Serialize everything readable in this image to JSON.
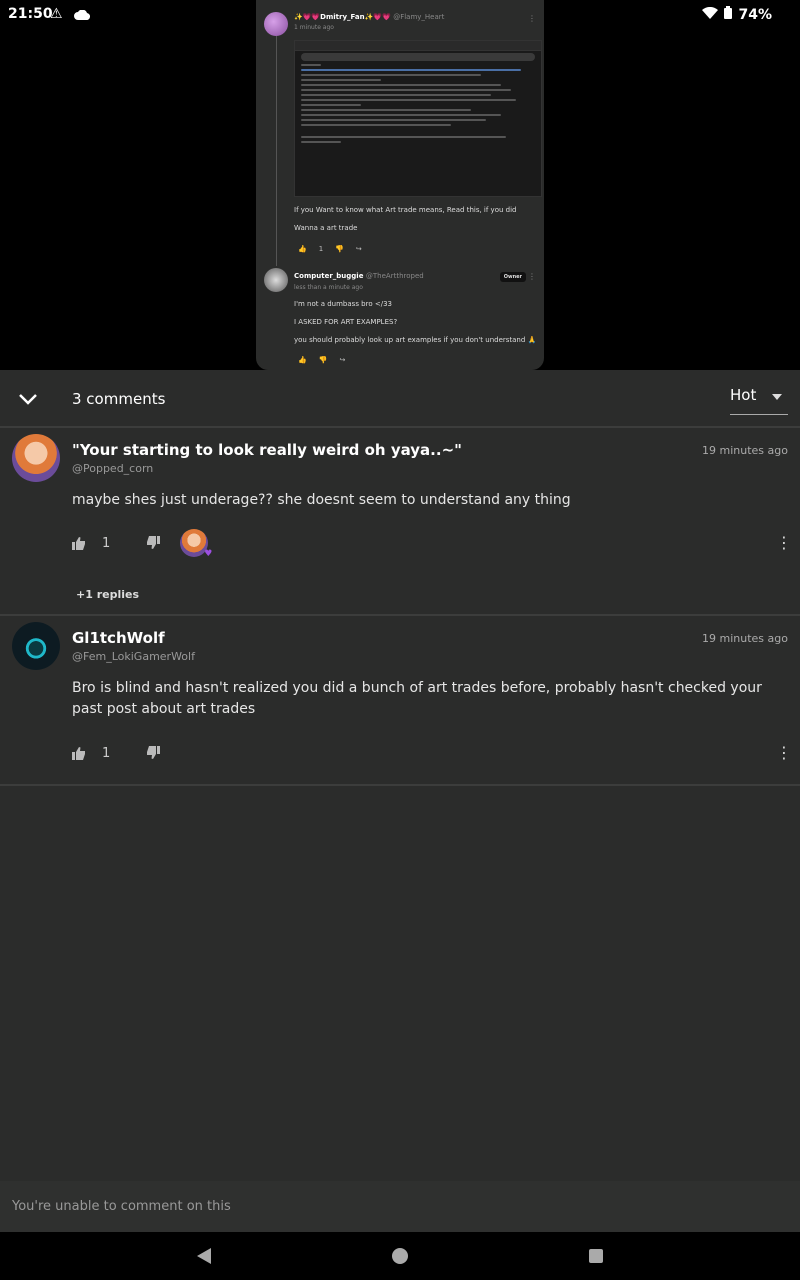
{
  "status": {
    "time": "21:50",
    "battery": "74%"
  },
  "preview": {
    "author": "✨💗💗Dmitry_Fan✨💗💗",
    "author_handle": "@Flamy_Heart",
    "time": "1 minute ago",
    "text1": "If you Want to know what Art trade means, Read this, if you did",
    "text2": "Wanna a art trade",
    "likes": "1",
    "reply_author": "Computer_buggie",
    "reply_handle": "@TheArtthroped",
    "reply_time": "less than a minute ago",
    "owner_badge": "Owner",
    "reply_line1": "I'm not a dumbass bro </33",
    "reply_line2": "I ASKED FOR ART EXAMPLES?",
    "reply_line3": "you should probably look up art examples if you don't understand 🙏"
  },
  "sheet": {
    "comment_count": "3 comments",
    "sort_label": "Hot"
  },
  "comments": [
    {
      "name": "\"Your starting to look really weird oh yaya..~\"",
      "handle": "@Popped_corn",
      "time": "19 minutes ago",
      "body": "maybe shes just underage?? she doesnt seem to understand any thing",
      "likes": "1",
      "replies": "+1 replies"
    },
    {
      "name": "Gl1tchWolf",
      "handle": "@Fem_LokiGamerWolf",
      "time": "19 minutes ago",
      "body": "Bro is blind and hasn't realized you did a bunch of art trades before, probably hasn't checked your past post about art trades",
      "likes": "1"
    }
  ],
  "footer": {
    "message": "You're unable to comment on this"
  }
}
